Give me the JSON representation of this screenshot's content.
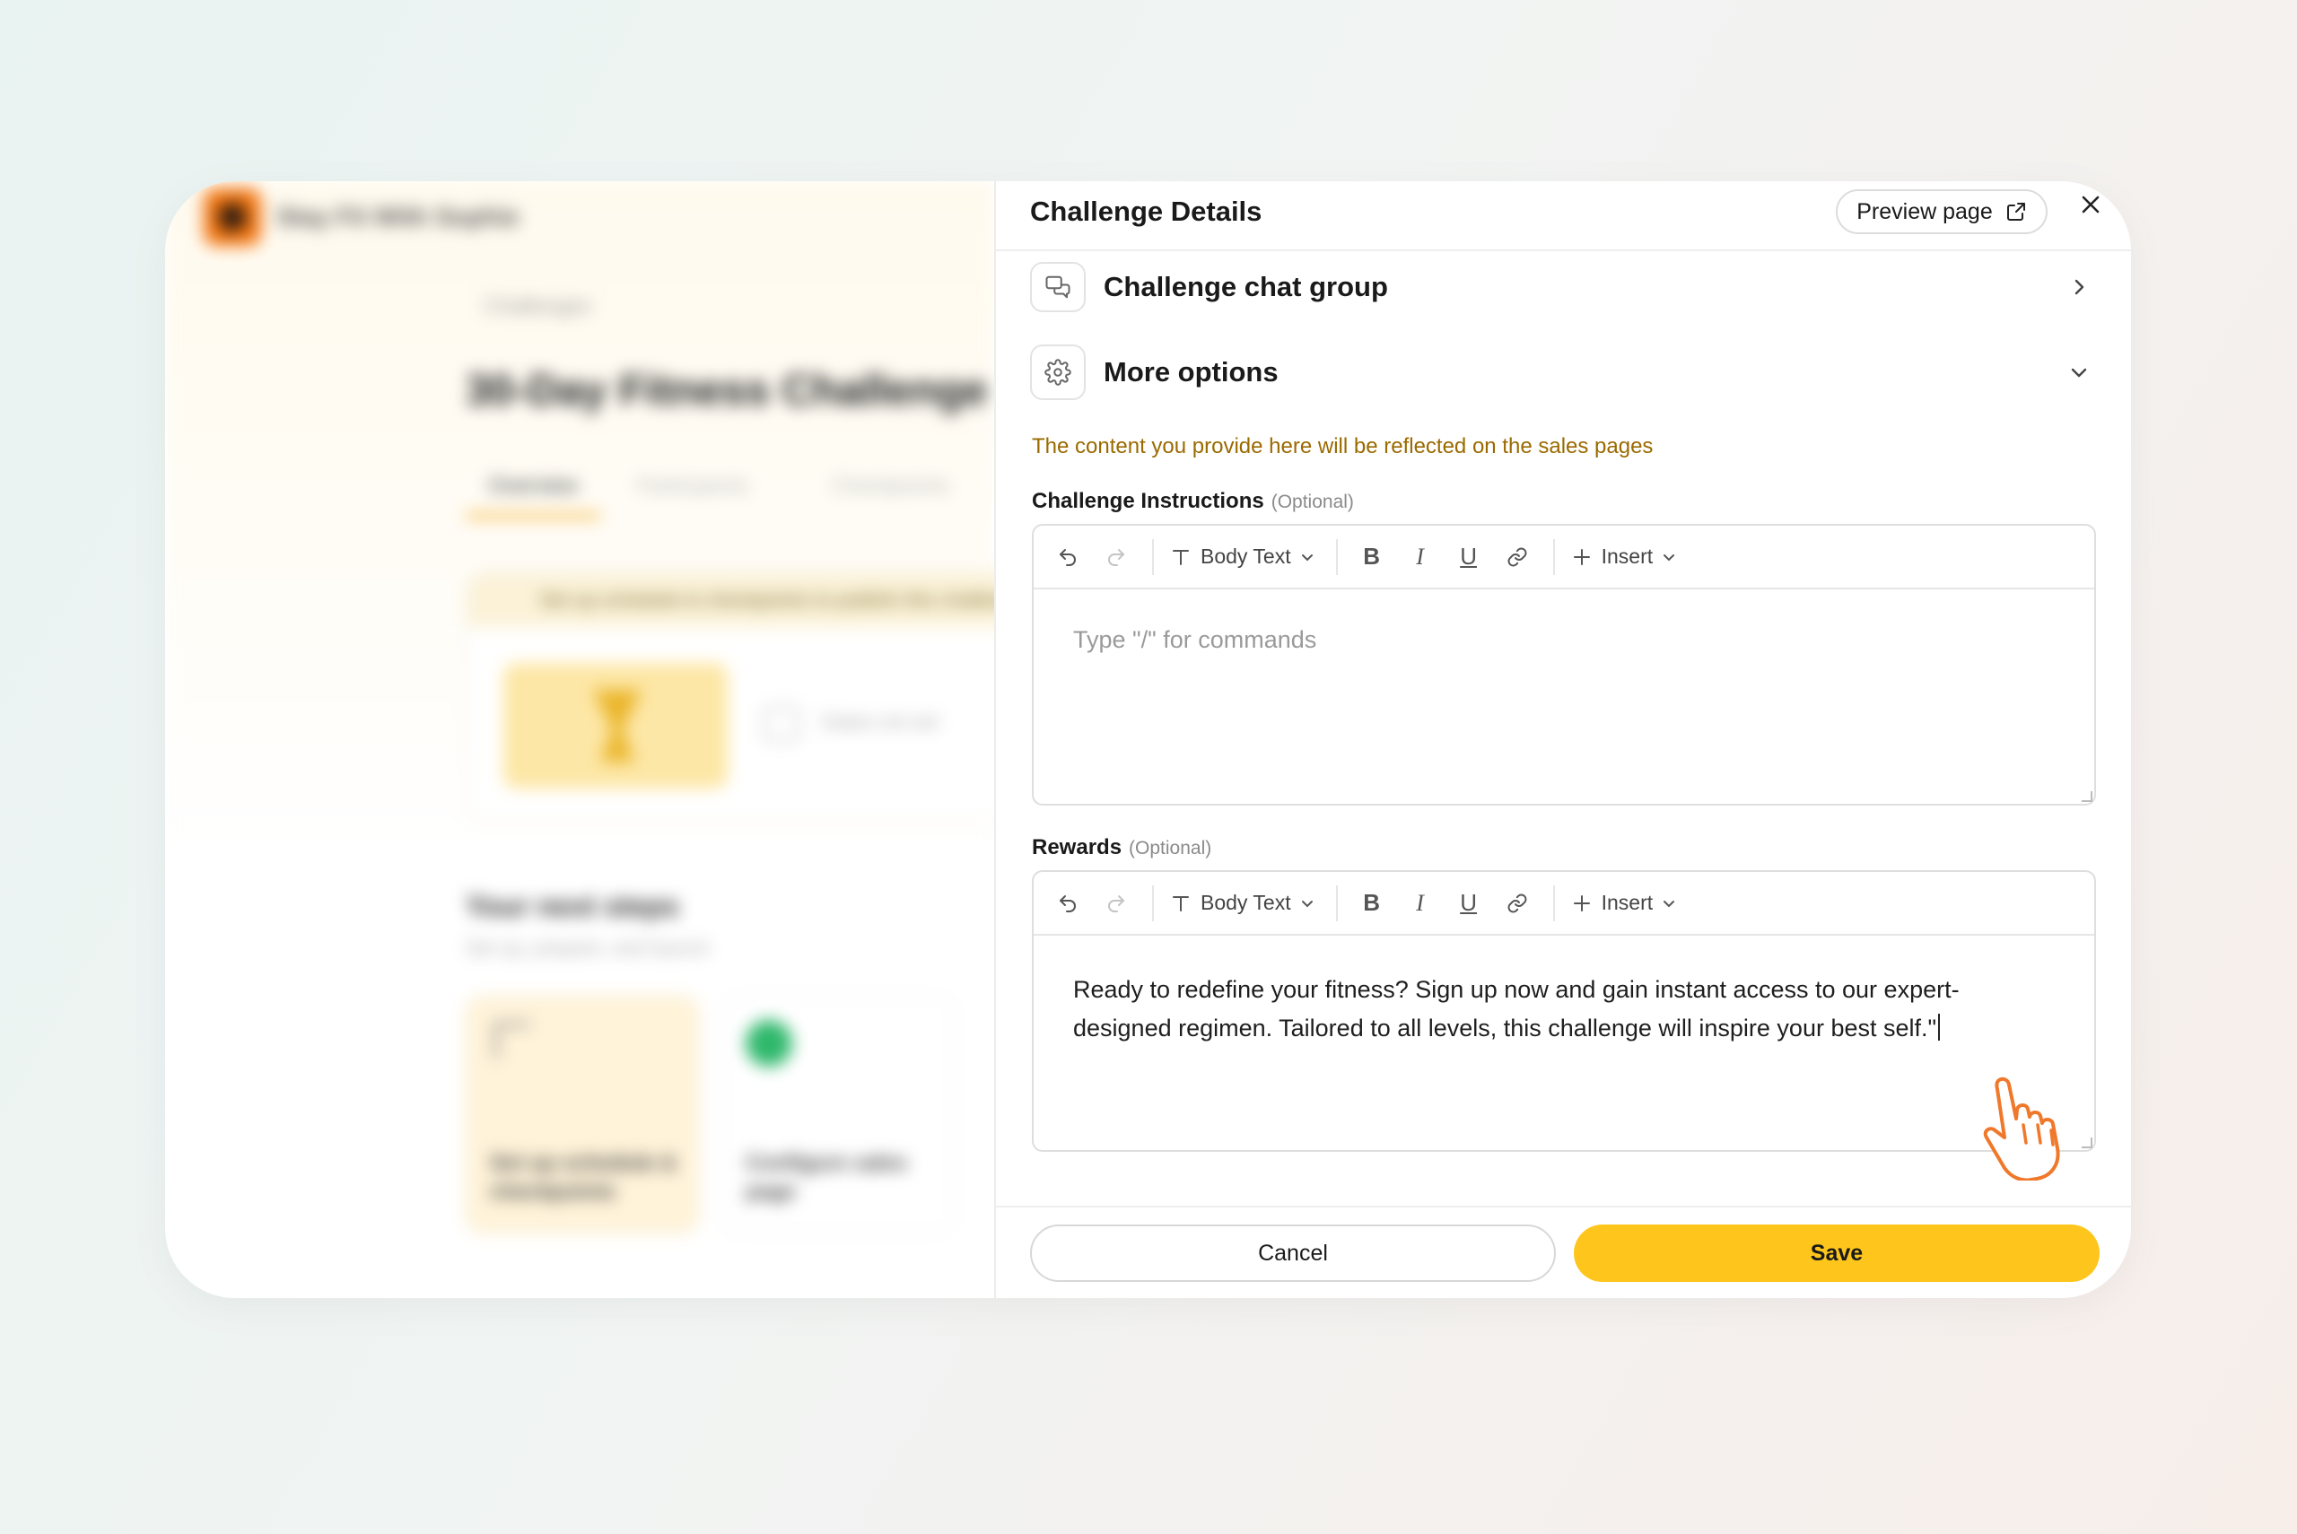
{
  "background_app": {
    "brand": "Stay Fit With Sophie",
    "breadcrumb": "Challenges",
    "page_title": "30-Day Fitness Challenge",
    "tabs": [
      "Overview",
      "Participants",
      "Checkpoints"
    ],
    "banner_text": "Set up schedule & checkpoints to publish this challenge",
    "dates_text": "Dates not set",
    "next_steps_title": "Your next steps",
    "next_steps_subtitle": "Set up, prepare, and launch",
    "steps": [
      "Set up schedule & checkpoints",
      "Configure sales page"
    ]
  },
  "panel": {
    "title": "Challenge Details",
    "preview_label": "Preview page",
    "close_icon": "close-icon"
  },
  "sections": {
    "chat_group": "Challenge chat group",
    "more_options": "More options"
  },
  "notice": "The content you provide here will be reflected on the sales pages",
  "instructions": {
    "label": "Challenge Instructions",
    "optional": "(Optional)",
    "placeholder": "Type \"/\" for commands",
    "text_style": "Body Text",
    "insert": "Insert"
  },
  "rewards": {
    "label": "Rewards",
    "optional": "(Optional)",
    "text_style": "Body Text",
    "insert": "Insert",
    "value": "Ready to redefine your fitness? Sign up now and gain instant access to our expert-designed regimen. Tailored to all levels, this challenge will inspire your best self.\""
  },
  "toolbar_letters": {
    "bold": "B",
    "italic": "I",
    "underline": "U"
  },
  "footer": {
    "cancel": "Cancel",
    "save": "Save"
  },
  "colors": {
    "accent": "#fec61c",
    "notice": "#9a6a00",
    "logo": "#f3750f"
  }
}
